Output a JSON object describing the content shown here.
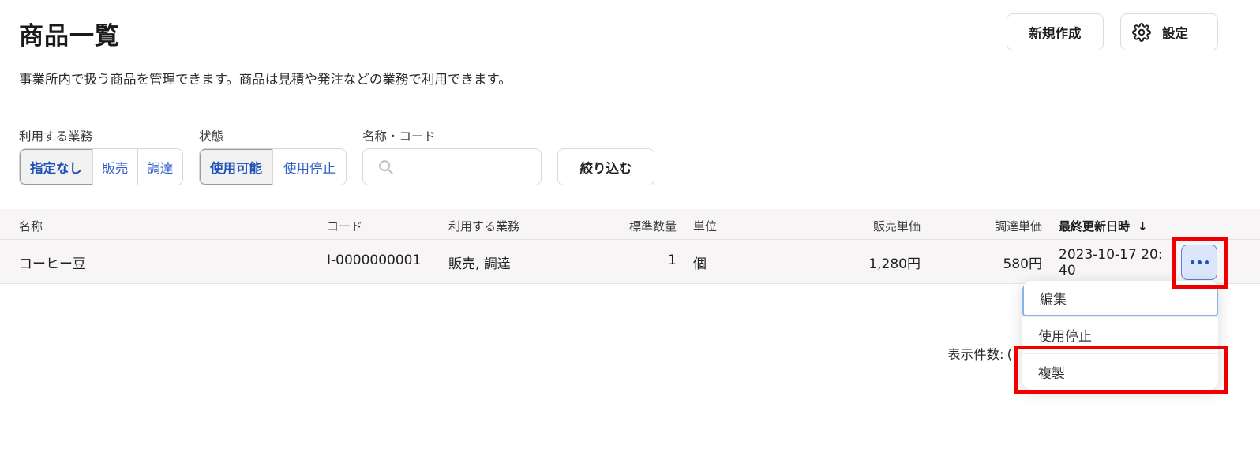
{
  "header": {
    "title": "商品一覧",
    "description": "事業所内で扱う商品を管理できます。商品は見積や発注などの業務で利用できます。",
    "new_button": "新規作成",
    "settings_button": "設定"
  },
  "filters": {
    "usage_label": "利用する業務",
    "usage_options": [
      "指定なし",
      "販売",
      "調達"
    ],
    "usage_selected": "指定なし",
    "status_label": "状態",
    "status_options": [
      "使用可能",
      "使用停止"
    ],
    "status_selected": "使用可能",
    "search_label": "名称・コード",
    "search_value": "",
    "search_placeholder": "",
    "apply_button": "絞り込む"
  },
  "table": {
    "columns": [
      "名称",
      "コード",
      "利用する業務",
      "標準数量",
      "単位",
      "販売単価",
      "調達単価",
      "最終更新日時"
    ],
    "sort_column": "最終更新日時",
    "sort_arrow": "↓",
    "rows": [
      {
        "name": "コーヒー豆",
        "code": "I-0000000001",
        "usage": "販売, 調達",
        "std_qty": "1",
        "unit": "個",
        "sale_price": "1,280円",
        "purchase_price": "580円",
        "updated_at": "2023-10-17 20:40"
      }
    ]
  },
  "pagination": {
    "page_size_label": "表示件数:",
    "page_size_value": "("
  },
  "row_menu": {
    "items": [
      "編集",
      "使用停止",
      "複製"
    ]
  },
  "icons": {
    "settings": "gear-icon",
    "search": "search-icon",
    "more": "more-horizontal-icon",
    "sort": "arrow-down-icon"
  },
  "colors": {
    "accent": "#1f4fb8",
    "highlight": "#ee0000",
    "row_bg": "#f7f5f5"
  }
}
